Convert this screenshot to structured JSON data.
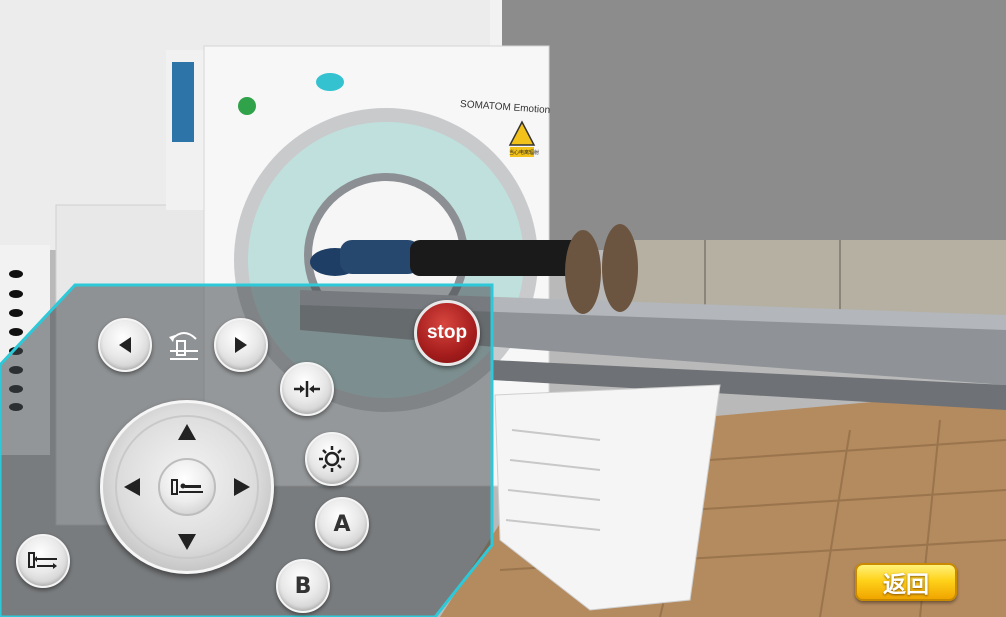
{
  "scene": {
    "machine_brand": "SOMATOM Emotion",
    "warning_sign_text": "当心电离辐射"
  },
  "controls": {
    "stop_label": "stop",
    "back_label": "返回",
    "button_a_label": "A",
    "button_b_label": "B",
    "icons": {
      "rotate_left": "triangle-left-icon",
      "rotate_right": "triangle-right-icon",
      "gantry_tilt": "gantry-tilt-icon",
      "laser": "laser-align-icon",
      "light": "light-sun-icon",
      "dpad_up": "triangle-up-icon",
      "dpad_down": "triangle-down-icon",
      "dpad_left": "triangle-left-icon",
      "dpad_right": "triangle-right-icon",
      "dpad_center": "patient-table-icon",
      "table_move": "table-move-icon"
    }
  },
  "colors": {
    "panel_border": "#2ec9d8",
    "stop_red": "#b02020",
    "back_yellow": "#ffd21a"
  }
}
